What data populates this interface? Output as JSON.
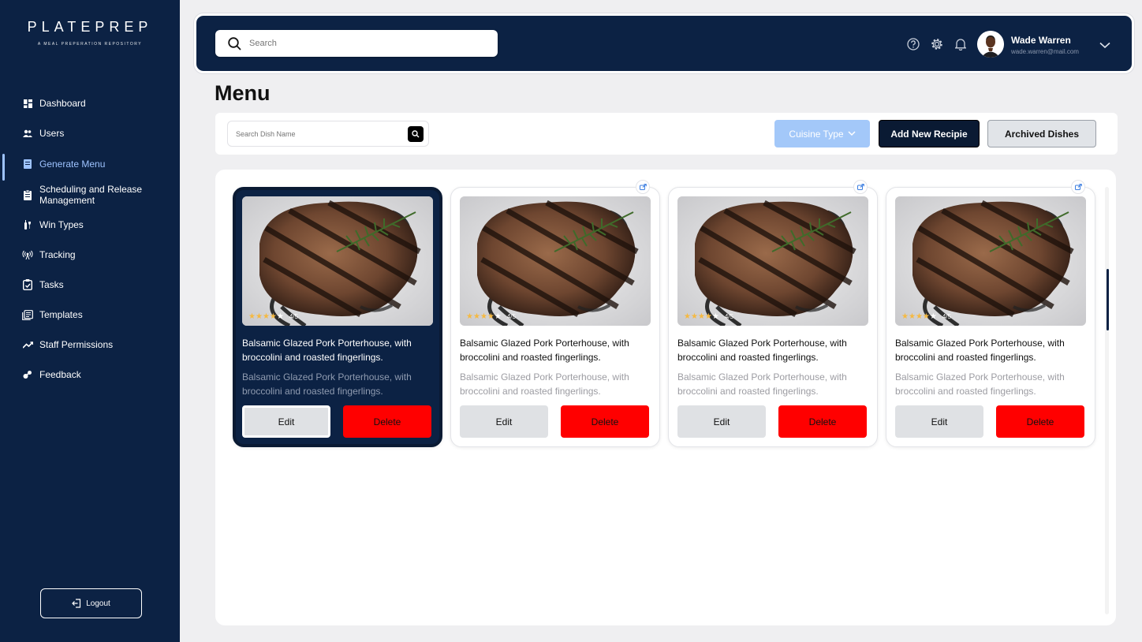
{
  "brand": {
    "name": "PLATEPREP",
    "tagline": "A MEAL PREPERATION REPOSITORY"
  },
  "sidebar": {
    "items": [
      {
        "label": "Dashboard",
        "icon": "dashboard-icon"
      },
      {
        "label": "Users",
        "icon": "users-icon"
      },
      {
        "label": "Generate Menu",
        "icon": "menu-icon",
        "active": true
      },
      {
        "label": "Scheduling and Release Management",
        "icon": "schedule-icon"
      },
      {
        "label": "Win Types",
        "icon": "wine-icon"
      },
      {
        "label": "Tracking",
        "icon": "tracking-icon"
      },
      {
        "label": "Tasks",
        "icon": "tasks-icon"
      },
      {
        "label": "Templates",
        "icon": "templates-icon"
      },
      {
        "label": "Staff Permissions",
        "icon": "permissions-icon"
      },
      {
        "label": "Feedback",
        "icon": "feedback-icon"
      }
    ],
    "logout_label": "Logout"
  },
  "header": {
    "search_placeholder": "Search",
    "user": {
      "name": "Wade Warren",
      "email": "wade.warren@mail.com"
    }
  },
  "main": {
    "title": "Menu",
    "dish_search_placeholder": "Search Dish Name",
    "cuisine_label": "Cuisine Type",
    "add_label": "Add New Recipie",
    "archived_label": "Archived Dishes",
    "cards": [
      {
        "title": "Balsamic Glazed Pork Porterhouse, with broccolini and roasted fingerlings.",
        "desc": "Balsamic Glazed Pork Porterhouse, with broccolini and roasted fingerlings.",
        "rating": "4/5",
        "stars": 4,
        "edit": "Edit",
        "delete": "Delete",
        "selected": true
      },
      {
        "title": "Balsamic Glazed Pork Porterhouse, with broccolini and roasted fingerlings.",
        "desc": "Balsamic Glazed Pork Porterhouse, with broccolini and roasted fingerlings.",
        "rating": "4/5",
        "stars": 4,
        "edit": "Edit",
        "delete": "Delete",
        "selected": false
      },
      {
        "title": "Balsamic Glazed Pork Porterhouse, with broccolini and roasted fingerlings.",
        "desc": "Balsamic Glazed Pork Porterhouse, with broccolini and roasted fingerlings.",
        "rating": "4/5",
        "stars": 4,
        "edit": "Edit",
        "delete": "Delete",
        "selected": false
      },
      {
        "title": "Balsamic Glazed Pork Porterhouse, with broccolini and roasted fingerlings.",
        "desc": "Balsamic Glazed Pork Porterhouse, with broccolini and roasted fingerlings.",
        "rating": "4/5",
        "stars": 4,
        "edit": "Edit",
        "delete": "Delete",
        "selected": false
      }
    ]
  },
  "colors": {
    "navy": "#0c2244",
    "accent": "#9ec3ff",
    "delete": "#ff0000",
    "cuisine": "#a3c8f9",
    "star": "#f5b942"
  }
}
